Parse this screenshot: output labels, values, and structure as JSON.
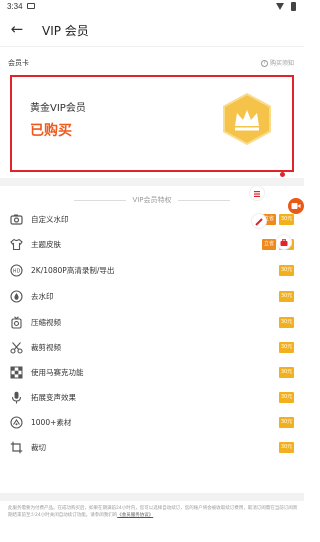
{
  "status_bar": {
    "time": "3:34"
  },
  "header": {
    "back_icon": "arrow-left-icon",
    "title": "VIP 会员"
  },
  "card_section": {
    "label": "会员卡",
    "notes": "购买须知"
  },
  "vip_card": {
    "title": "黄金VIP会员",
    "status": "已购买",
    "badge_icon": "crown-icon"
  },
  "privileges": {
    "title": "VIP会员特权",
    "items": [
      {
        "icon": "camera-watermark-icon",
        "label": "自定义水印",
        "tag": "立省",
        "badge": "30元"
      },
      {
        "icon": "shirt-icon",
        "label": "主题皮肤",
        "tag": "立省",
        "badge": "30元"
      },
      {
        "icon": "hd-icon",
        "label": "2K/1080P高清录制/导出",
        "tag": "",
        "badge": "30元"
      },
      {
        "icon": "drop-icon",
        "label": "去水印",
        "tag": "",
        "badge": "30元"
      },
      {
        "icon": "compress-video-icon",
        "label": "压缩视频",
        "tag": "",
        "badge": "30元"
      },
      {
        "icon": "scissors-icon",
        "label": "裁剪视频",
        "tag": "",
        "badge": "30元"
      },
      {
        "icon": "mosaic-icon",
        "label": "使用马赛克功能",
        "tag": "",
        "badge": "30元"
      },
      {
        "icon": "microphone-icon",
        "label": "拓展变声效果",
        "tag": "",
        "badge": "30元"
      },
      {
        "icon": "materials-icon",
        "label": "1000+素材",
        "tag": "",
        "badge": "30元"
      },
      {
        "icon": "crop-icon",
        "label": "裁切",
        "tag": "",
        "badge": "30元"
      }
    ]
  },
  "footer": {
    "text": "此服务需要为付费产品。在成功购买后，如果在期满前24小时内，您可以选择自动续订，您的账户将会被收取续订费用，取消订阅需在当前订阅周期结束前至少24小时关闭自动续订功能。请参阅我们的",
    "link": "《会员服务协议》"
  },
  "colors": {
    "accent": "#f05a1e",
    "highlight_border": "#e0242a",
    "badge": "#f2b01e",
    "tag": "#f0891c",
    "gold": "#f5c34a"
  }
}
